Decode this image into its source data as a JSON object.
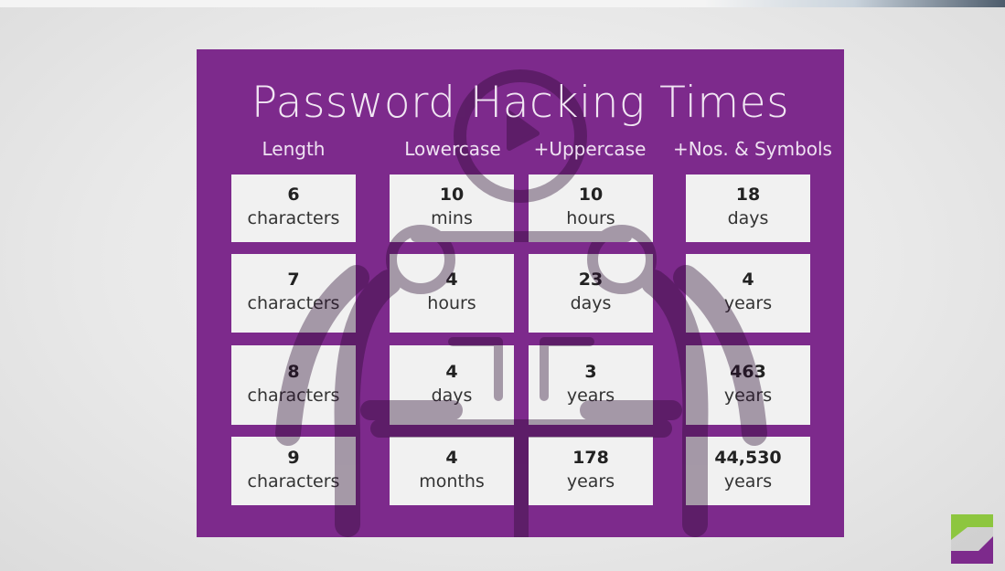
{
  "slide": {
    "title": "Password Hacking Times",
    "headers": {
      "length": "Length",
      "lowercase": "Lowercase",
      "uppercase": "+Uppercase",
      "symbols": "+Nos. & Symbols"
    },
    "rows": [
      {
        "length": {
          "num": "6",
          "unit": "characters"
        },
        "lowercase": {
          "num": "10",
          "unit": "mins"
        },
        "uppercase": {
          "num": "10",
          "unit": "hours"
        },
        "symbols": {
          "num": "18",
          "unit": "days"
        }
      },
      {
        "length": {
          "num": "7",
          "unit": "characters"
        },
        "lowercase": {
          "num": "4",
          "unit": "hours"
        },
        "uppercase": {
          "num": "23",
          "unit": "days"
        },
        "symbols": {
          "num": "4",
          "unit": "years"
        }
      },
      {
        "length": {
          "num": "8",
          "unit": "characters"
        },
        "lowercase": {
          "num": "4",
          "unit": "days"
        },
        "uppercase": {
          "num": "3",
          "unit": "years"
        },
        "symbols": {
          "num": "463",
          "unit": "years"
        }
      },
      {
        "length": {
          "num": "9",
          "unit": "characters"
        },
        "lowercase": {
          "num": "4",
          "unit": "months"
        },
        "uppercase": {
          "num": "178",
          "unit": "years"
        },
        "symbols": {
          "num": "44,530",
          "unit": "years"
        }
      }
    ]
  },
  "logo": {
    "name": "z-logo"
  },
  "colors": {
    "board": "#7d2a8c",
    "cell": "#f1f1f1",
    "logo_green": "#8dc63f",
    "logo_purple": "#7d2a8c"
  }
}
